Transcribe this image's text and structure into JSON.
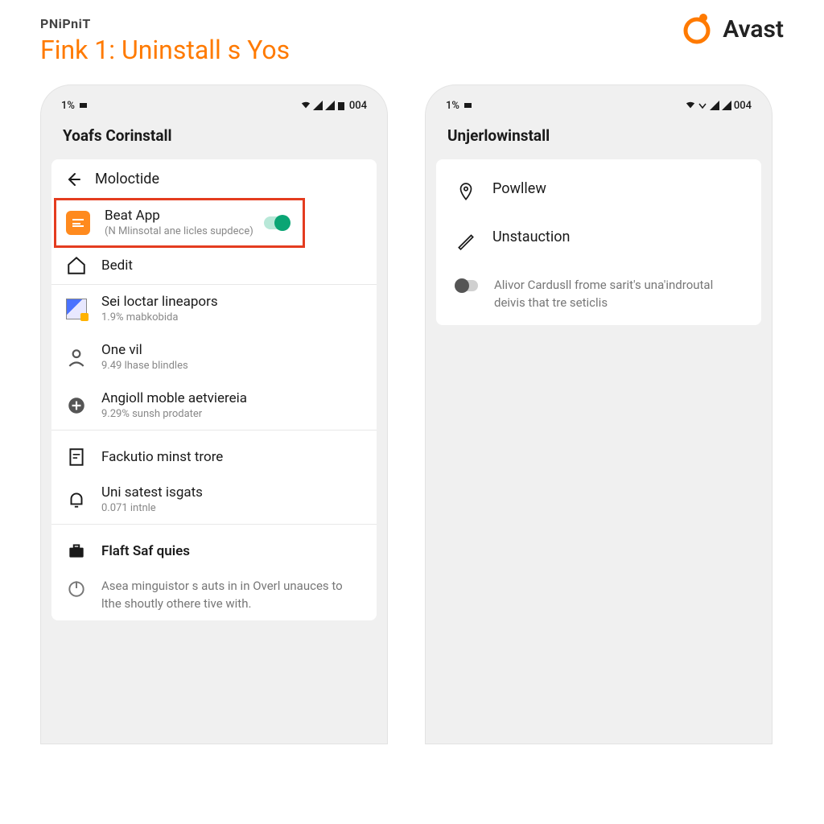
{
  "header": {
    "brand_small": "PNiPniT",
    "step_title": "Fink 1: Uninstall s Yos",
    "avast_label": "Avast"
  },
  "status": {
    "battery": "1%",
    "time": "004"
  },
  "left_phone": {
    "screen_title": "Yoafs Corinstall",
    "back_label": "Moloctide",
    "highlighted": {
      "title": "Beat App",
      "sub": "(N Mlinsotal ane licles supdece)"
    },
    "items": [
      {
        "icon": "home",
        "title": "Bedit",
        "sub": ""
      },
      {
        "icon": "picture",
        "title": "Sei loctar lineapors",
        "sub": "1.9% mabkobida"
      },
      {
        "icon": "person",
        "title": "One vil",
        "sub": "9.49 lhase blindles"
      },
      {
        "icon": "plus-circle",
        "title": "Angioll moble aetviereia",
        "sub": "9.29% sunsh prodater"
      }
    ],
    "items2": [
      {
        "icon": "doc",
        "title": "Fackutio minst trore",
        "sub": ""
      },
      {
        "icon": "bell",
        "title": "Uni satest isgats",
        "sub": "0.071 intnle"
      }
    ],
    "items3": [
      {
        "icon": "briefcase",
        "title": "Flaft Saf quies",
        "sub": ""
      }
    ],
    "footer": "Asea minguistor s auts in in Overl unauces to lthe shoutly othere tive with.",
    "footer_icon": "power"
  },
  "right_phone": {
    "screen_title": "Unjerlowinstall",
    "items": [
      {
        "icon": "pin",
        "title": "Powllew"
      },
      {
        "icon": "pen",
        "title": "Unstauction"
      }
    ],
    "switch_desc": "Alivor Cardusll frome sarit's una'indroutal deivis that tre seticlis"
  }
}
